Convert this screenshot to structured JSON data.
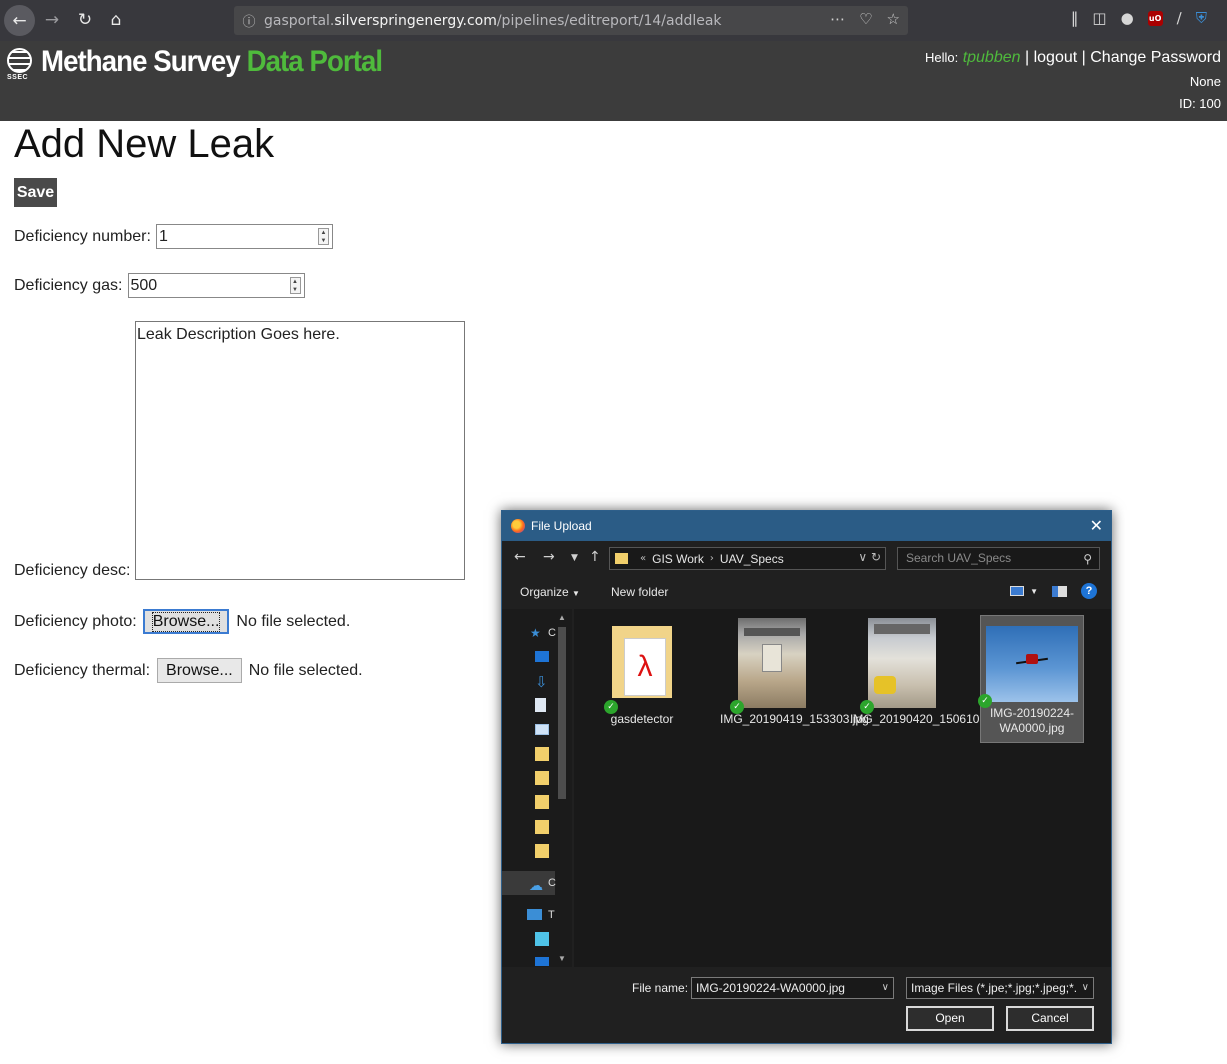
{
  "browser": {
    "url_prefix": "gasportal.",
    "url_host": "silverspringenergy.com",
    "url_path": "/pipelines/editreport/14/addleak"
  },
  "site": {
    "logo_text": "SSEC",
    "title_white": "Methane Survey",
    "title_green": "Data Portal",
    "hello": "Hello:",
    "username": "tpubben",
    "logout": "logout",
    "change_password": "Change Password",
    "separator": "|",
    "company": "None",
    "id_label": "ID: 100"
  },
  "form": {
    "title": "Add New Leak",
    "save": "Save",
    "number_label": "Deficiency number:",
    "number_value": "1",
    "gas_label": "Deficiency gas:",
    "gas_value": "500",
    "desc_label": "Deficiency desc:",
    "desc_value": "Leak Description Goes here.",
    "photo_label": "Deficiency photo:",
    "thermal_label": "Deficiency thermal:",
    "browse": "Browse...",
    "no_file": "No file selected."
  },
  "dialog": {
    "title": "File Upload",
    "path_prefix": "«",
    "path": [
      "GIS Work",
      "UAV_Specs"
    ],
    "search_placeholder": "Search UAV_Specs",
    "organize": "Organize",
    "new_folder": "New folder",
    "nav_items": [
      {
        "icon": "quick-access-icon",
        "label": "C"
      },
      {
        "icon": "onedrive-icon",
        "label": "C"
      },
      {
        "icon": "this-pc-icon",
        "label": "T"
      }
    ],
    "files": [
      {
        "name": "gasdetector",
        "type": "folder"
      },
      {
        "name": "IMG_20190419_153303.jpg",
        "type": "image"
      },
      {
        "name": "IMG_20190420_150610.jpg",
        "type": "image"
      },
      {
        "name": "IMG-20190224-WA0000.jpg",
        "type": "image",
        "selected": true
      }
    ],
    "file_name_label": "File name:",
    "file_name_value": "IMG-20190224-WA0000.jpg",
    "file_type_value": "Image Files (*.jpe;*.jpg;*.jpeg;*.",
    "open": "Open",
    "cancel": "Cancel"
  }
}
